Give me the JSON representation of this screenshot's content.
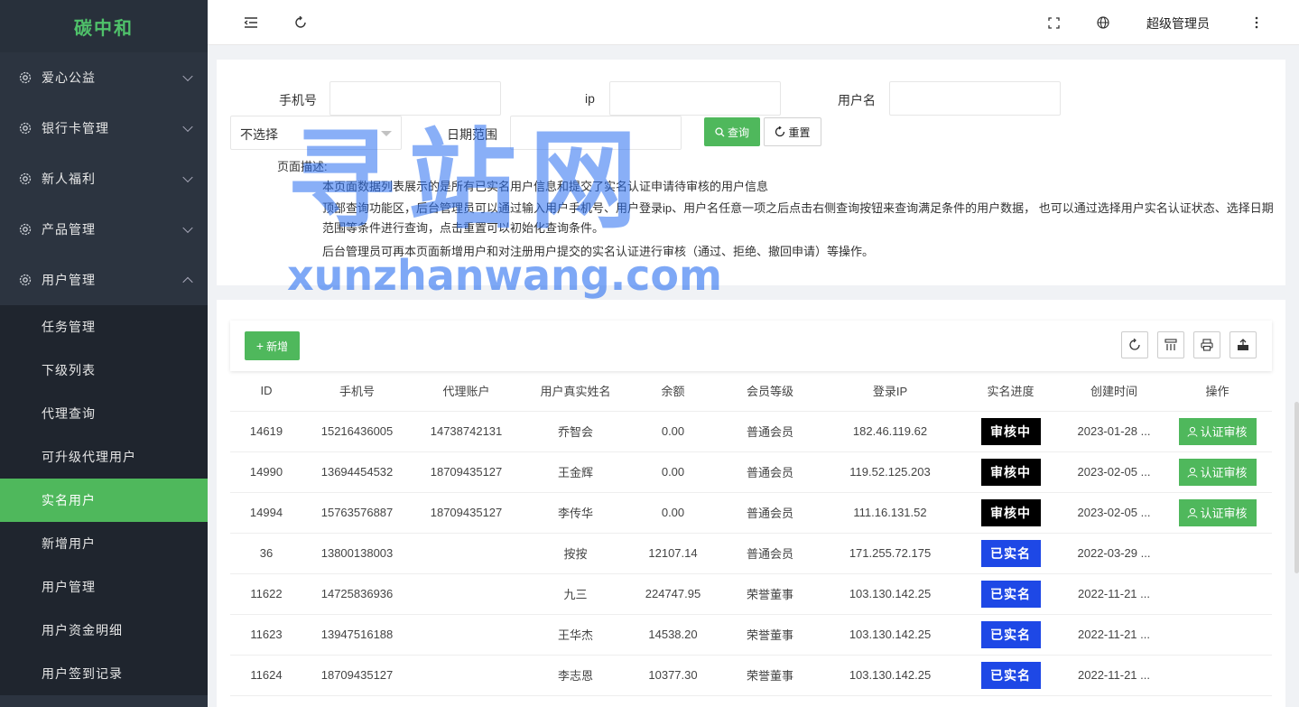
{
  "sidebar": {
    "brand": "碳中和",
    "groups": [
      {
        "label": "爱心公益"
      },
      {
        "label": "银行卡管理"
      },
      {
        "label": "新人福利"
      },
      {
        "label": "产品管理"
      },
      {
        "label": "用户管理"
      }
    ],
    "sub_items": [
      {
        "label": "任务管理"
      },
      {
        "label": "下级列表"
      },
      {
        "label": "代理查询"
      },
      {
        "label": "可升级代理用户"
      },
      {
        "label": "实名用户"
      },
      {
        "label": "新增用户"
      },
      {
        "label": "用户管理"
      },
      {
        "label": "用户资金明细"
      },
      {
        "label": "用户签到记录"
      }
    ]
  },
  "topbar": {
    "admin_name": "超级管理员"
  },
  "search": {
    "phone_label": "手机号",
    "phone_value": "",
    "ip_label": "ip",
    "ip_value": "",
    "username_label": "用户名",
    "username_value": "",
    "status_select": "不选择",
    "date_label": "日期范围",
    "date_value": "",
    "query_label": "查询",
    "reset_label": "重置"
  },
  "description": {
    "title": "页面描述:",
    "line1": "本页面数据列表展示的是所有已实名用户信息和提交了实名认证申请待审核的用户信息",
    "line2": "顶部查询功能区，后台管理员可以通过输入用户手机号、用户登录ip、用户名任意一项之后点击右侧查询按钮来查询满足条件的用户数据， 也可以通过选择用户实名认证状态、选择日期范围等条件进行查询，点击重置可以初始化查询条件。",
    "line3": "后台管理员可再本页面新增用户和对注册用户提交的实名认证进行审核（通过、拒绝、撤回申请）等操作。"
  },
  "toolbar": {
    "add_label": "新增"
  },
  "table": {
    "headers": [
      "ID",
      "手机号",
      "代理账户",
      "用户真实姓名",
      "余额",
      "会员等级",
      "登录IP",
      "实名进度",
      "创建时间",
      "操作"
    ],
    "rows": [
      {
        "id": "14619",
        "phone": "15216436005",
        "agent": "14738742131",
        "name": "乔智会",
        "balance": "0.00",
        "level": "普通会员",
        "ip": "182.46.119.62",
        "status": "审核中",
        "created": "2023-01-28 ...",
        "action": "认证审核"
      },
      {
        "id": "14990",
        "phone": "13694454532",
        "agent": "18709435127",
        "name": "王金辉",
        "balance": "0.00",
        "level": "普通会员",
        "ip": "119.52.125.203",
        "status": "审核中",
        "created": "2023-02-05 ...",
        "action": "认证审核"
      },
      {
        "id": "14994",
        "phone": "15763576887",
        "agent": "18709435127",
        "name": "李传华",
        "balance": "0.00",
        "level": "普通会员",
        "ip": "111.16.131.52",
        "status": "审核中",
        "created": "2023-02-05 ...",
        "action": "认证审核"
      },
      {
        "id": "36",
        "phone": "13800138003",
        "agent": "",
        "name": "按按",
        "balance": "12107.14",
        "level": "普通会员",
        "ip": "171.255.72.175",
        "status": "已实名",
        "created": "2022-03-29 ...",
        "action": ""
      },
      {
        "id": "11622",
        "phone": "14725836936",
        "agent": "",
        "name": "九三",
        "balance": "224747.95",
        "level": "荣誉董事",
        "ip": "103.130.142.25",
        "status": "已实名",
        "created": "2022-11-21 ...",
        "action": ""
      },
      {
        "id": "11623",
        "phone": "13947516188",
        "agent": "",
        "name": "王华杰",
        "balance": "14538.20",
        "level": "荣誉董事",
        "ip": "103.130.142.25",
        "status": "已实名",
        "created": "2022-11-21 ...",
        "action": ""
      },
      {
        "id": "11624",
        "phone": "18709435127",
        "agent": "",
        "name": "李志恩",
        "balance": "10377.30",
        "level": "荣誉董事",
        "ip": "103.130.142.25",
        "status": "已实名",
        "created": "2022-11-21 ...",
        "action": ""
      }
    ]
  },
  "watermark": {
    "main": "寻站网",
    "url": "xunzhanwang.com"
  },
  "colors": {
    "sidebar_bg": "#2c3440",
    "brand": "#4fc16a",
    "active": "#4fb85c",
    "pending_badge": "#000000",
    "verified_badge": "#1e48e6"
  }
}
